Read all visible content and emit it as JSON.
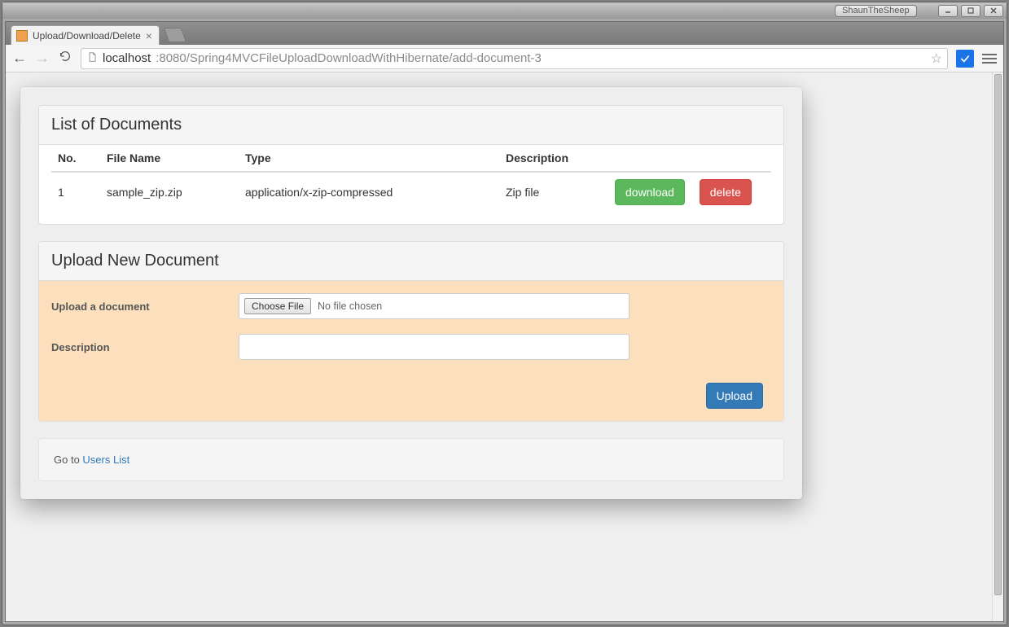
{
  "os": {
    "app_badge": "ShaunTheSheep"
  },
  "browser": {
    "tab_title": "Upload/Download/Delete",
    "url_host": "localhost",
    "url_port_path": ":8080/Spring4MVCFileUploadDownloadWithHibernate/add-document-3"
  },
  "page": {
    "list_heading": "List of Documents",
    "columns": {
      "no": "No.",
      "file_name": "File Name",
      "type": "Type",
      "description": "Description"
    },
    "rows": [
      {
        "no": "1",
        "file_name": "sample_zip.zip",
        "type": "application/x-zip-compressed",
        "description": "Zip file",
        "download_label": "download",
        "delete_label": "delete"
      }
    ],
    "upload_heading": "Upload New Document",
    "form": {
      "upload_label": "Upload a document",
      "choose_button": "Choose File",
      "no_file_text": "No file chosen",
      "description_label": "Description",
      "description_value": "",
      "submit_label": "Upload"
    },
    "footer": {
      "prefix": "Go to ",
      "link_text": "Users List"
    }
  }
}
